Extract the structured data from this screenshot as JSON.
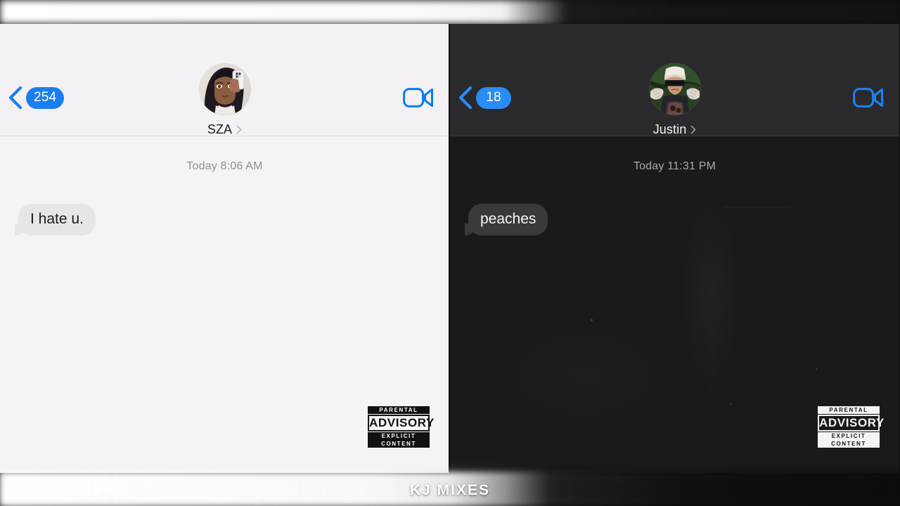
{
  "watermark": "KJ MIXES",
  "accent_blue": "#1a7ef0",
  "panels": [
    {
      "theme": "light",
      "background": "#f6f3f6",
      "header": {
        "back_badge_count": "254",
        "back_icon": "chevron-left-icon",
        "contact_name": "SZA",
        "disclosure_icon": "chevron-right-icon",
        "avatar_icon": "contact-avatar-sza",
        "facetime_icon": "video-camera-icon"
      },
      "thread": {
        "timestamp": "Today 8:06 AM",
        "messages": [
          {
            "text": "I hate u.",
            "side": "incoming"
          }
        ]
      },
      "advisory": {
        "line1": "PARENTAL",
        "line2": "ADVISORY",
        "line3": "EXPLICIT CONTENT",
        "style": "dark-on-light"
      }
    },
    {
      "theme": "dark",
      "background": "#1a1a1c",
      "header": {
        "back_badge_count": "18",
        "back_icon": "chevron-left-icon",
        "contact_name": "Justin",
        "disclosure_icon": "chevron-right-icon",
        "avatar_icon": "contact-avatar-justin",
        "facetime_icon": "video-camera-icon"
      },
      "thread": {
        "timestamp": "Today 11:31 PM",
        "messages": [
          {
            "text": "peaches",
            "side": "incoming"
          }
        ]
      },
      "advisory": {
        "line1": "PARENTAL",
        "line2": "ADVISORY",
        "line3": "EXPLICIT CONTENT",
        "style": "light-on-dark"
      }
    }
  ]
}
